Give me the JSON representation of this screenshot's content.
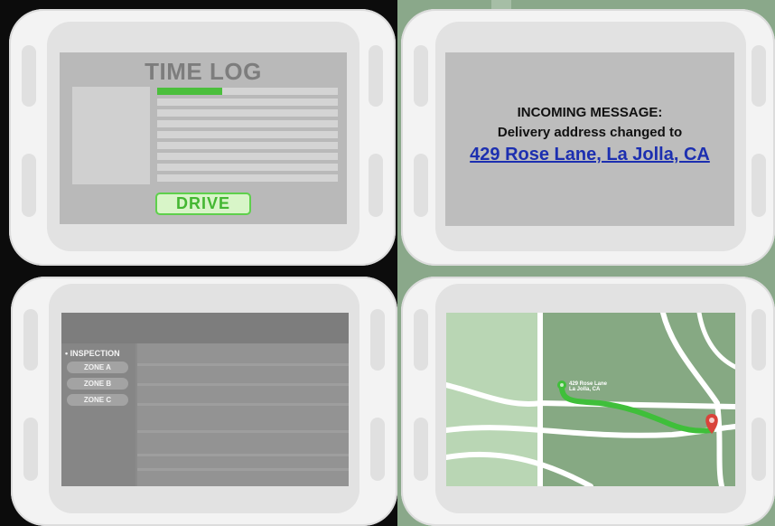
{
  "time_log": {
    "title": "TIME LOG",
    "progress_fraction": 0.36,
    "drive_button_label": "DRIVE"
  },
  "message": {
    "heading": "INCOMING MESSAGE:",
    "body": "Delivery address changed to",
    "address_link": "429 Rose Lane, La Jolla, CA"
  },
  "inspection": {
    "menu_heading": "• INSPECTION",
    "zones": [
      "ZONE A",
      "ZONE B",
      "ZONE C"
    ]
  },
  "map": {
    "destination_line1": "429 Rose Lane",
    "destination_line2": "La Jolla, CA",
    "route_color": "#3fbf3a",
    "pin_color": "#d9433a"
  }
}
